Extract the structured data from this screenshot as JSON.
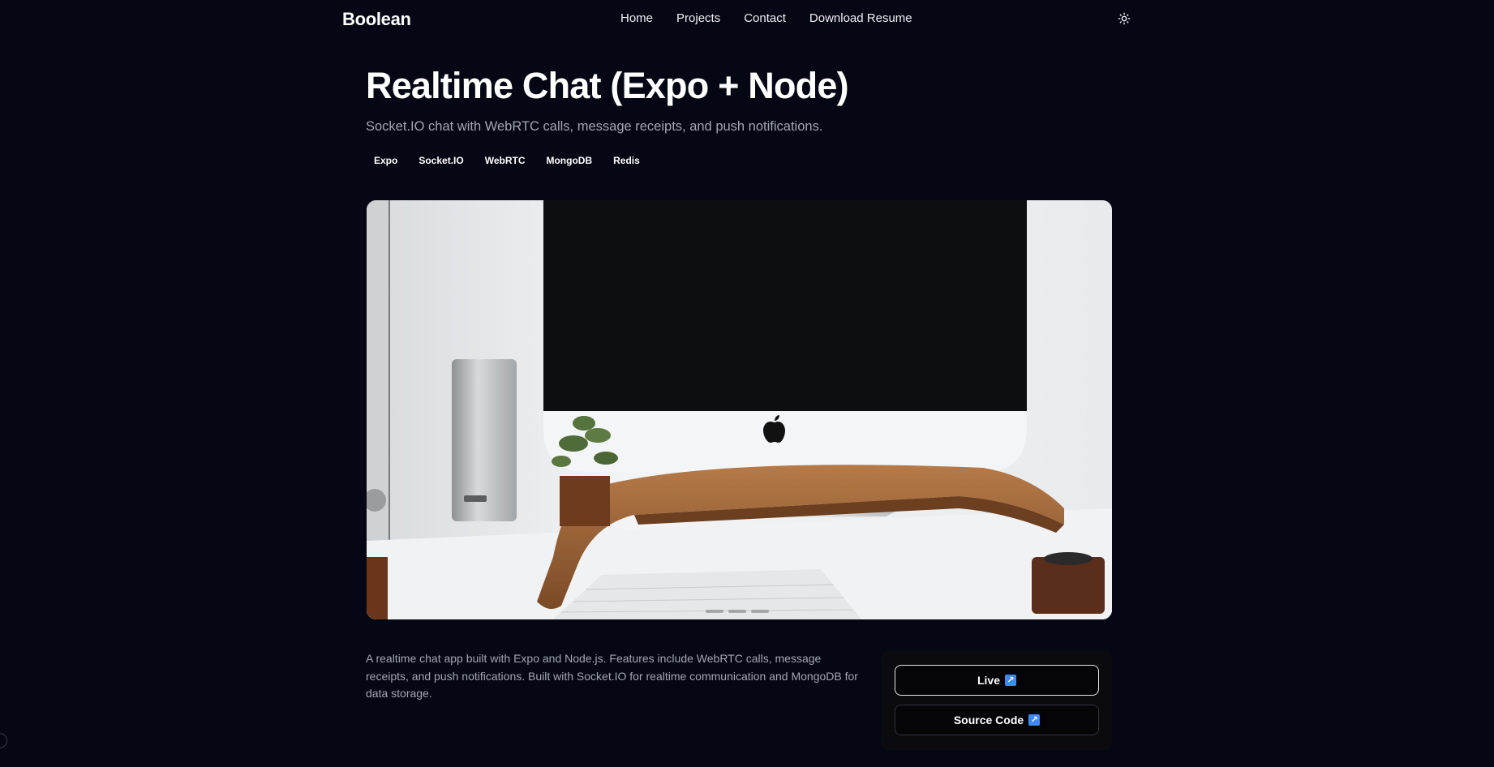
{
  "nav": {
    "brand": "Boolean",
    "links": [
      "Home",
      "Projects",
      "Contact",
      "Download Resume"
    ],
    "theme_icon": "sun-icon"
  },
  "project": {
    "title": "Realtime Chat (Expo + Node)",
    "subtitle": "Socket.IO chat with WebRTC calls, message receipts, and push notifications.",
    "tags": [
      "Expo",
      "Socket.IO",
      "WebRTC",
      "MongoDB",
      "Redis"
    ],
    "description": "A realtime chat app built with Expo and Node.js. Features include WebRTC calls, message receipts, and push notifications. Built with Socket.IO for realtime communication and MongoDB for data storage."
  },
  "gallery": {
    "slide_count": 3,
    "active_slide": 1
  },
  "actions": {
    "live_label": "Live",
    "source_label": "Source Code",
    "external_icon": "external-link-icon"
  }
}
